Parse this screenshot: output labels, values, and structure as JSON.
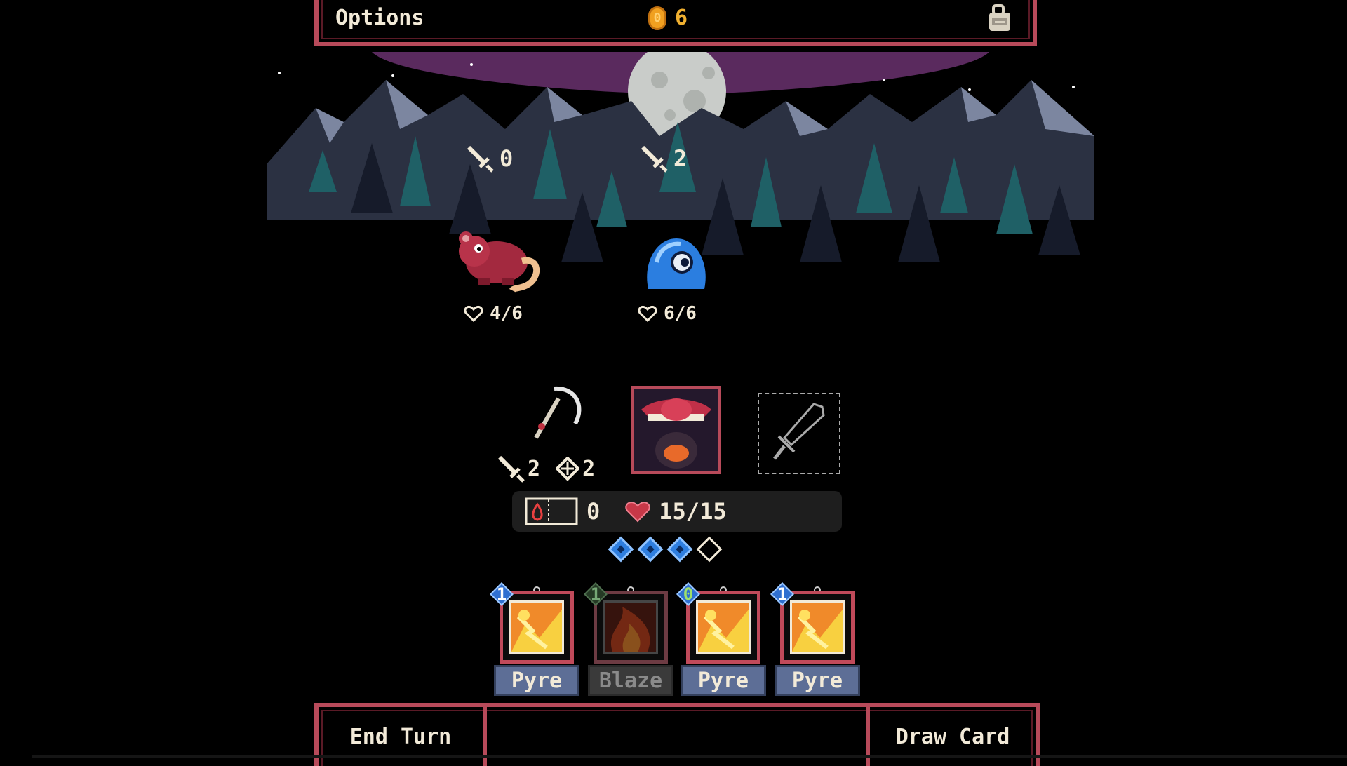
{
  "topbar": {
    "options_label": "Options",
    "gold": "6",
    "coin_glyph": "0",
    "bag_icon": "bag-icon"
  },
  "enemies": [
    {
      "name": "rat",
      "intent_attack": "0",
      "hp": "4/6"
    },
    {
      "name": "slime",
      "intent_attack": "2",
      "hp": "6/6"
    }
  ],
  "hero": {
    "weapon_attack": "2",
    "weapon_shield": "2",
    "burn": "0",
    "hp": "15/15",
    "energy_total": 4,
    "energy_filled": 3
  },
  "hand": [
    {
      "cost": "1",
      "name": "Pyre",
      "playable": true
    },
    {
      "cost": "1",
      "name": "Blaze",
      "playable": false
    },
    {
      "cost": "0",
      "name": "Pyre",
      "playable": true
    },
    {
      "cost": "1",
      "name": "Pyre",
      "playable": true
    }
  ],
  "bottombar": {
    "end_turn_label": "End Turn",
    "draw_card_label": "Draw Card"
  },
  "colors": {
    "frame": "#b74a5a",
    "card_name_bg": "#5d6e96",
    "energy": "#2f7fe0",
    "gold": "#f0b030",
    "sky_glow": "#5a2a5e"
  }
}
